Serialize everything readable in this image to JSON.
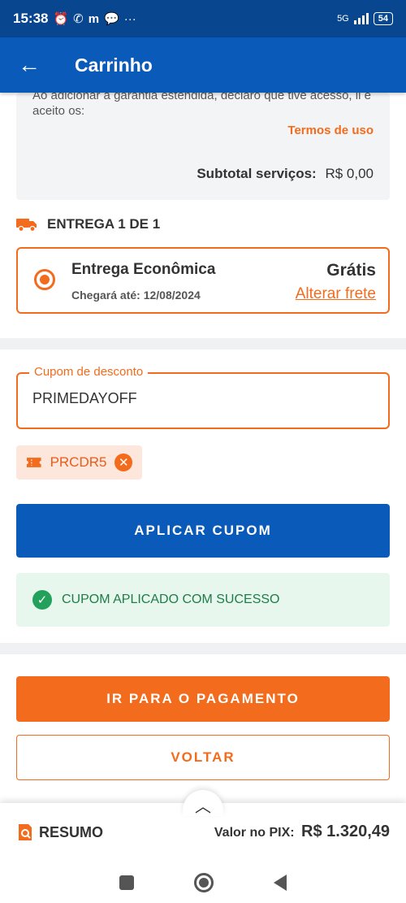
{
  "status_bar": {
    "time": "15:38",
    "network": "5G",
    "battery": "54"
  },
  "app_bar": {
    "title": "Carrinho"
  },
  "terms": {
    "text": "Ao adicionar a garantia estendida, declaro que tive acesso, li e aceito os:",
    "link": "Termos de uso",
    "subtotal_label": "Subtotal serviços:",
    "subtotal_value": "R$ 0,00"
  },
  "delivery": {
    "heading": "ENTREGA 1 DE 1",
    "option_name": "Entrega Econômica",
    "option_date": "Chegará até: 12/08/2024",
    "option_price": "Grátis",
    "change_link": "Alterar frete"
  },
  "coupon": {
    "label": "Cupom de desconto",
    "value": "PRIMEDAYOFF",
    "applied_code": "PRCDR5",
    "apply_button": "APLICAR CUPOM",
    "success_message": "CUPOM APLICADO COM SUCESSO"
  },
  "actions": {
    "payment_button": "IR PARA O PAGAMENTO",
    "back_button": "VOLTAR"
  },
  "summary": {
    "label": "RESUMO",
    "pix_label": "Valor no PIX:",
    "pix_value": "R$ 1.320,49"
  },
  "colors": {
    "primary_blue": "#0a5ab9",
    "accent_orange": "#f36b1c",
    "success_green": "#23a05a"
  }
}
